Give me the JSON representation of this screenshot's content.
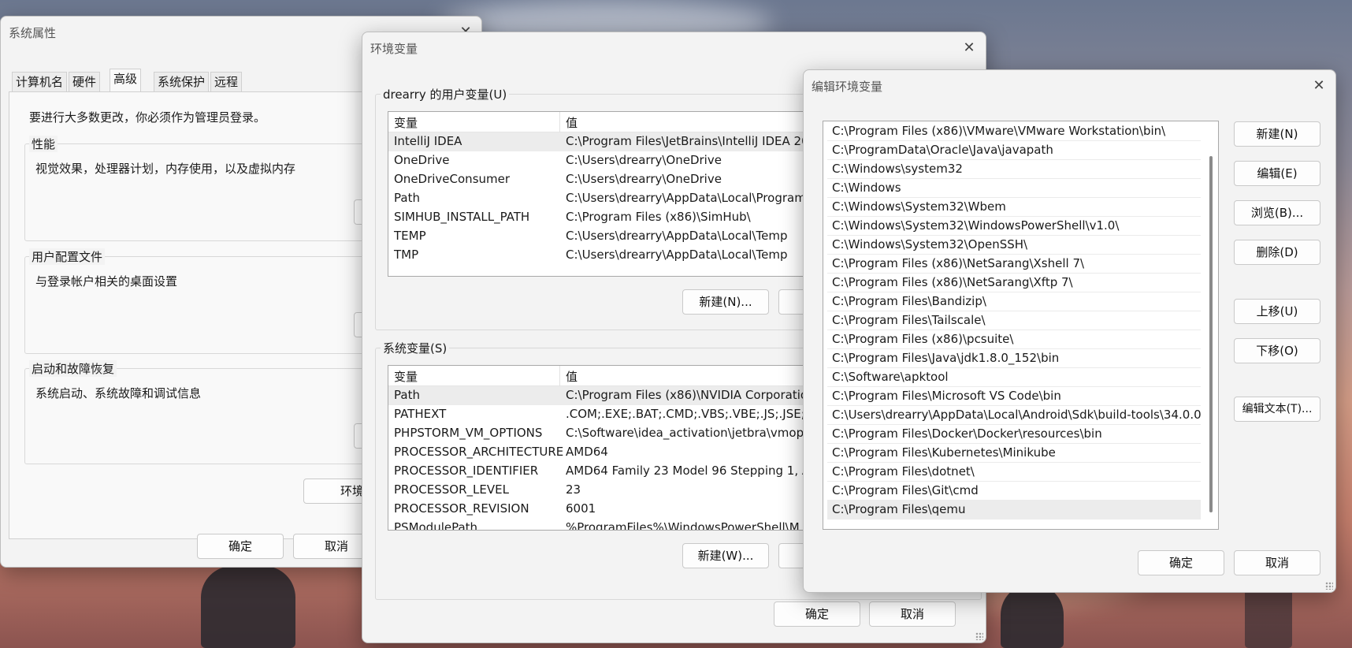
{
  "sysprops": {
    "title": "系统属性",
    "tabs": [
      "计算机名",
      "硬件",
      "高级",
      "系统保护",
      "远程"
    ],
    "admin_note": "要进行大多数更改，你必须作为管理员登录。",
    "perf_title": "性能",
    "perf_desc": "视觉效果，处理器计划，内存使用，以及虚拟内存",
    "profile_title": "用户配置文件",
    "profile_desc": "与登录帐户相关的桌面设置",
    "startup_title": "启动和故障恢复",
    "startup_desc": "系统启动、系统故障和调试信息",
    "env_button": "环境",
    "ok": "确定",
    "cancel": "取消"
  },
  "envvars": {
    "title": "环境变量",
    "user_group_title": "drearry 的用户变量(U)",
    "system_group_title": "系统变量(S)",
    "col_var": "变量",
    "col_val": "值",
    "user_vars": [
      {
        "name": "IntelliJ IDEA",
        "value": "C:\\Program Files\\JetBrains\\IntelliJ IDEA 20"
      },
      {
        "name": "OneDrive",
        "value": "C:\\Users\\drearry\\OneDrive"
      },
      {
        "name": "OneDriveConsumer",
        "value": "C:\\Users\\drearry\\OneDrive"
      },
      {
        "name": "Path",
        "value": "C:\\Users\\drearry\\AppData\\Local\\Program"
      },
      {
        "name": "SIMHUB_INSTALL_PATH",
        "value": "C:\\Program Files (x86)\\SimHub\\"
      },
      {
        "name": "TEMP",
        "value": "C:\\Users\\drearry\\AppData\\Local\\Temp"
      },
      {
        "name": "TMP",
        "value": "C:\\Users\\drearry\\AppData\\Local\\Temp"
      }
    ],
    "system_vars": [
      {
        "name": "Path",
        "value": "C:\\Program Files (x86)\\NVIDIA Corporation"
      },
      {
        "name": "PATHEXT",
        "value": ".COM;.EXE;.BAT;.CMD;.VBS;.VBE;.JS;.JSE;.W"
      },
      {
        "name": "PHPSTORM_VM_OPTIONS",
        "value": "C:\\Software\\idea_activation\\jetbra\\vmopt"
      },
      {
        "name": "PROCESSOR_ARCHITECTURE",
        "value": "AMD64"
      },
      {
        "name": "PROCESSOR_IDENTIFIER",
        "value": "AMD64 Family 23 Model 96 Stepping 1, A"
      },
      {
        "name": "PROCESSOR_LEVEL",
        "value": "23"
      },
      {
        "name": "PROCESSOR_REVISION",
        "value": "6001"
      },
      {
        "name": "PSModulePath",
        "value": "%ProgramFiles%\\WindowsPowerShell\\M"
      }
    ],
    "new_user": "新建(N)...",
    "edit_user_partial": "编",
    "new_system": "新建(W)...",
    "edit_system_partial": "编",
    "ok": "确定",
    "cancel": "取消"
  },
  "editenv": {
    "title": "编辑环境变量",
    "paths": [
      "C:\\Program Files (x86)\\VMware\\VMware Workstation\\bin\\",
      "C:\\ProgramData\\Oracle\\Java\\javapath",
      "C:\\Windows\\system32",
      "C:\\Windows",
      "C:\\Windows\\System32\\Wbem",
      "C:\\Windows\\System32\\WindowsPowerShell\\v1.0\\",
      "C:\\Windows\\System32\\OpenSSH\\",
      "C:\\Program Files (x86)\\NetSarang\\Xshell 7\\",
      "C:\\Program Files (x86)\\NetSarang\\Xftp 7\\",
      "C:\\Program Files\\Bandizip\\",
      "C:\\Program Files\\Tailscale\\",
      "C:\\Program Files (x86)\\pcsuite\\",
      "C:\\Program Files\\Java\\jdk1.8.0_152\\bin",
      "C:\\Software\\apktool",
      "C:\\Program Files\\Microsoft VS Code\\bin",
      "C:\\Users\\drearry\\AppData\\Local\\Android\\Sdk\\build-tools\\34.0.0",
      "C:\\Program Files\\Docker\\Docker\\resources\\bin",
      "C:\\Program Files\\Kubernetes\\Minikube",
      "C:\\Program Files\\dotnet\\",
      "C:\\Program Files\\Git\\cmd",
      "C:\\Program Files\\qemu"
    ],
    "buttons": {
      "new": "新建(N)",
      "edit": "编辑(E)",
      "browse": "浏览(B)...",
      "delete": "删除(D)",
      "up": "上移(U)",
      "down": "下移(O)",
      "edit_text": "编辑文本(T)..."
    },
    "ok": "确定",
    "cancel": "取消"
  }
}
